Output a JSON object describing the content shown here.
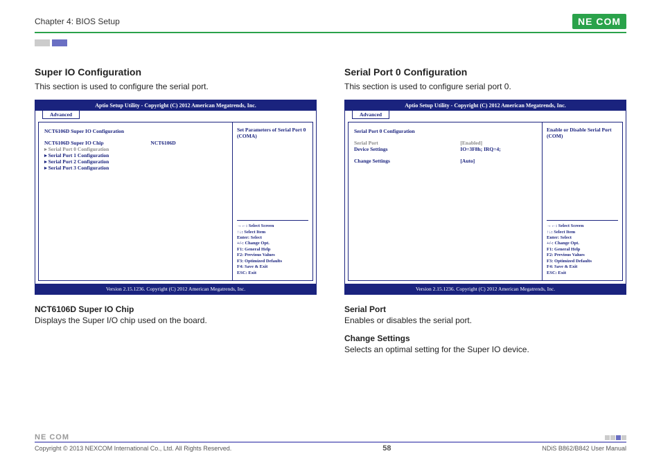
{
  "header": {
    "chapter": "Chapter 4: BIOS Setup",
    "logo": "NE COM"
  },
  "left": {
    "title": "Super IO Configuration",
    "desc": "This section is used to configure the serial port.",
    "bios": {
      "title": "Aptio Setup Utility - Copyright (C) 2012 American Megatrends, Inc.",
      "tab": "Advanced",
      "heading": "NCT6106D Super IO Configuration",
      "chip_label": "NCT6106D Super IO Chip",
      "chip_value": "NCT6106D",
      "items": [
        "▸ Serial Port 0 Configuration",
        "▸ Serial Port 1 Configuration",
        "▸ Serial Port 2 Configuration",
        "▸ Serial Port 3 Configuration"
      ],
      "help_top": "Set Parameters of Serial Port 0 (COMA)",
      "help_keys": [
        "→←: Select Screen",
        "↑↓: Select Item",
        "Enter: Select",
        "+/-: Change Opt.",
        "F1: General Help",
        "F2: Previous Values",
        "F3: Optimized Defaults",
        "F4: Save & Exit",
        "ESC: Exit"
      ],
      "footer": "Version 2.15.1236. Copyright (C) 2012 American Megatrends, Inc."
    },
    "sub": {
      "h": "NCT6106D Super IO Chip",
      "p": "Displays the Super I/O chip used on the board."
    }
  },
  "right": {
    "title": "Serial Port 0 Configuration",
    "desc": "This section is used to configure serial port 0.",
    "bios": {
      "title": "Aptio Setup Utility - Copyright (C) 2012 American Megatrends, Inc.",
      "tab": "Advanced",
      "heading": "Serial Port 0 Configuration",
      "rows": [
        {
          "lbl": "Serial Port",
          "val": "[Enabled]",
          "grey": true
        },
        {
          "lbl": "Device Settings",
          "val": "IO=3F8h; IRQ=4;",
          "grey": false
        },
        {
          "lbl": "",
          "val": "",
          "grey": false
        },
        {
          "lbl": "Change Settings",
          "val": "[Auto]",
          "grey": false
        }
      ],
      "help_top": "Enable or Disable Serial Port (COM)",
      "help_keys": [
        "→←: Select Screen",
        "↑↓: Select Item",
        "Enter: Select",
        "+/-: Change Opt.",
        "F1: General Help",
        "F2: Previous Values",
        "F3: Optimized Defaults",
        "F4: Save & Exit",
        "ESC: Exit"
      ],
      "footer": "Version 2.15.1236. Copyright (C) 2012 American Megatrends, Inc."
    },
    "subs": [
      {
        "h": "Serial Port",
        "p": "Enables or disables the serial port."
      },
      {
        "h": "Change Settings",
        "p": "Selects an optimal setting for the Super IO device."
      }
    ]
  },
  "footer": {
    "copyright": "Copyright © 2013 NEXCOM International Co., Ltd. All Rights Reserved.",
    "page": "58",
    "manual": "NDiS B862/B842 User Manual",
    "logo": "NE COM"
  }
}
